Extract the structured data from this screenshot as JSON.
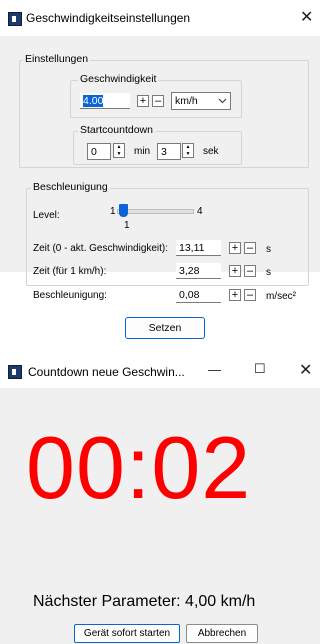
{
  "window1": {
    "title": "Geschwindigkeitseinstellungen",
    "close_glyph": "✕",
    "einstellungen": {
      "label": "Einstellungen",
      "geschwindigkeit": {
        "label": "Geschwindigkeit",
        "value": "4.00",
        "plus": "+",
        "minus": "–",
        "unit_selected": "km/h"
      },
      "startcountdown": {
        "label": "Startcountdown",
        "min_value": "0",
        "min_unit": "min",
        "sek_value": "3",
        "sek_unit": "sek"
      }
    },
    "beschleunigung": {
      "label": "Beschleunigung",
      "level_label": "Level:",
      "slider_min": "1",
      "slider_max": "4",
      "slider_value": "1",
      "slider_fraction": 0.0,
      "rows": [
        {
          "label": "Zeit (0 - akt. Geschwindigkeit):",
          "value": "13,11",
          "unit": "s"
        },
        {
          "label": "Zeit (für 1 km/h):",
          "value": "3,28",
          "unit": "s"
        },
        {
          "label": "Beschleunigung:",
          "value": "0,08",
          "unit": "m/sec²"
        }
      ],
      "plus": "+",
      "minus": "–"
    },
    "setzen_label": "Setzen"
  },
  "window2": {
    "title": "Countdown neue Geschwin...",
    "minimize_glyph": "—",
    "maximize_glyph": "☐",
    "close_glyph": "✕",
    "timer": "00:02",
    "next_parameter": "Nächster Parameter: 4,00 km/h",
    "start_now_label": "Gerät sofort starten",
    "cancel_label": "Abbrechen"
  },
  "colors": {
    "accent": "#0a64d6",
    "timer": "#ff0000",
    "dialog_bg": "#f0f0f0"
  },
  "icons": [
    "app-icon",
    "close-icon",
    "minimize-icon",
    "maximize-icon",
    "spin-up-icon",
    "spin-down-icon",
    "chevron-down-icon"
  ]
}
